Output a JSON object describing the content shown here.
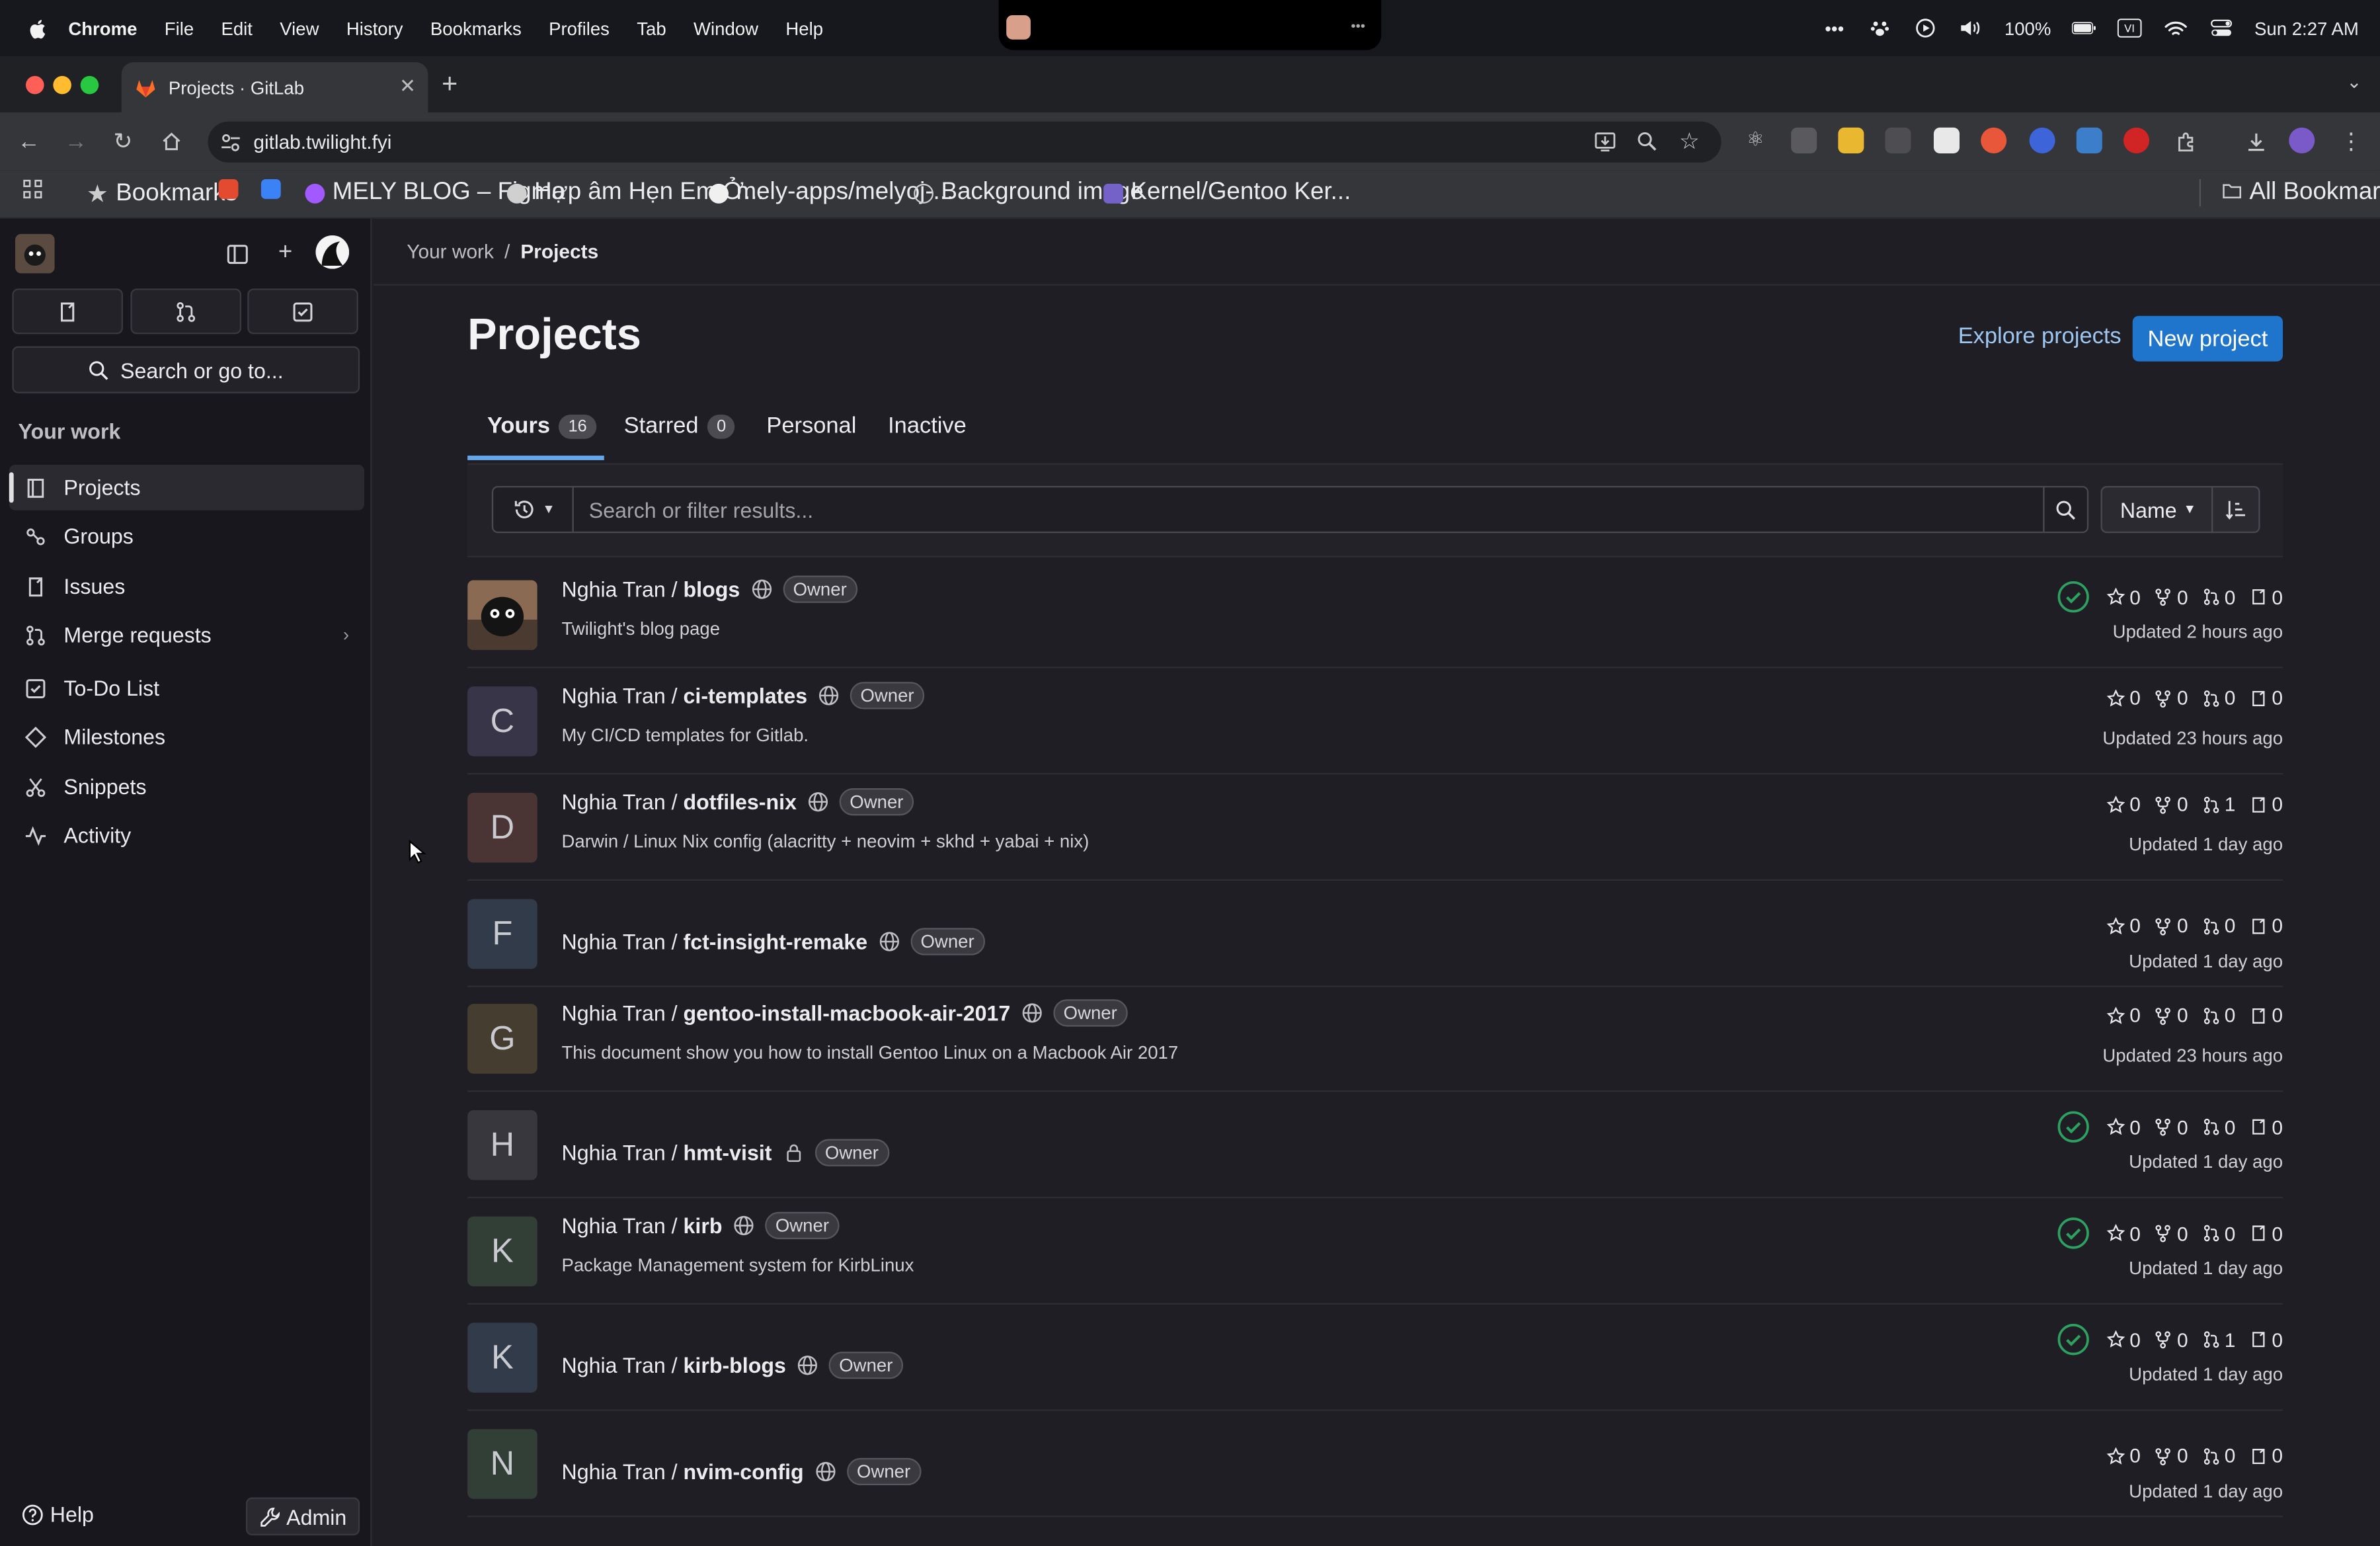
{
  "menubar": {
    "app": "Chrome",
    "items": [
      "File",
      "Edit",
      "View",
      "History",
      "Bookmarks",
      "Profiles",
      "Tab",
      "Window",
      "Help"
    ],
    "battery": "100%",
    "clock": "Sun 2:27 AM"
  },
  "browser": {
    "tab_title": "Projects · GitLab",
    "url": "gitlab.twilight.fyi",
    "bookmarks": [
      "Bookmarks",
      "MELY BLOG – Figma",
      "Hợp âm Hẹn Em Ở...",
      "mely-apps/melyoj-...",
      "Background image",
      "Kernel/Gentoo Ker..."
    ],
    "all_bookmarks": "All Bookmarks"
  },
  "sidebar": {
    "search_label": "Search or go to...",
    "section": "Your work",
    "items": [
      {
        "label": "Projects",
        "icon": "project-icon",
        "active": true
      },
      {
        "label": "Groups",
        "icon": "group-icon"
      },
      {
        "label": "Issues",
        "icon": "issues-icon"
      },
      {
        "label": "Merge requests",
        "icon": "merge-request-icon"
      },
      {
        "label": "To-Do List",
        "icon": "todo-icon"
      },
      {
        "label": "Milestones",
        "icon": "milestone-icon"
      },
      {
        "label": "Snippets",
        "icon": "snippet-icon"
      },
      {
        "label": "Activity",
        "icon": "activity-icon"
      }
    ],
    "help": "Help",
    "admin": "Admin"
  },
  "breadcrumb": {
    "parent": "Your work",
    "current": "Projects"
  },
  "page": {
    "title": "Projects",
    "explore": "Explore projects",
    "new_project": "New project"
  },
  "tabs": [
    {
      "label": "Yours",
      "count": "16"
    },
    {
      "label": "Starred",
      "count": "0"
    },
    {
      "label": "Personal"
    },
    {
      "label": "Inactive"
    }
  ],
  "filter": {
    "placeholder": "Search or filter results...",
    "sort": "Name"
  },
  "projects": [
    {
      "namespace": "Nghia Tran / ",
      "name": "blogs",
      "visibility": "public",
      "role": "Owner",
      "description": "Twilight's blog page",
      "pipeline": true,
      "stars": "0",
      "forks": "0",
      "mrs": "0",
      "issues": "0",
      "updated": "Updated 2 hours ago",
      "letter": "",
      "avatar_color": "#3a3530"
    },
    {
      "namespace": "Nghia Tran / ",
      "name": "ci-templates",
      "visibility": "public",
      "role": "Owner",
      "description": "My CI/CD templates for Gitlab.",
      "pipeline": false,
      "stars": "0",
      "forks": "0",
      "mrs": "0",
      "issues": "0",
      "updated": "Updated 23 hours ago",
      "letter": "C",
      "avatar_color": "#393548"
    },
    {
      "namespace": "Nghia Tran / ",
      "name": "dotfiles-nix",
      "visibility": "public",
      "role": "Owner",
      "description": "Darwin / Linux Nix config (alacritty + neovim + skhd + yabai + nix)",
      "pipeline": false,
      "stars": "0",
      "forks": "0",
      "mrs": "1",
      "issues": "0",
      "updated": "Updated 1 day ago",
      "letter": "D",
      "avatar_color": "#4a3434"
    },
    {
      "namespace": "Nghia Tran / ",
      "name": "fct-insight-remake",
      "visibility": "public",
      "role": "Owner",
      "description": "",
      "pipeline": false,
      "stars": "0",
      "forks": "0",
      "mrs": "0",
      "issues": "0",
      "updated": "Updated 1 day ago",
      "letter": "F",
      "avatar_color": "#313b4a"
    },
    {
      "namespace": "Nghia Tran / ",
      "name": "gentoo-install-macbook-air-2017",
      "visibility": "public",
      "role": "Owner",
      "description": "This document show you how to install Gentoo Linux on a Macbook Air 2017",
      "pipeline": false,
      "stars": "0",
      "forks": "0",
      "mrs": "0",
      "issues": "0",
      "updated": "Updated 23 hours ago",
      "letter": "G",
      "avatar_color": "#453d30"
    },
    {
      "namespace": "Nghia Tran / ",
      "name": "hmt-visit",
      "visibility": "private",
      "role": "Owner",
      "description": "",
      "pipeline": true,
      "stars": "0",
      "forks": "0",
      "mrs": "0",
      "issues": "0",
      "updated": "Updated 1 day ago",
      "letter": "H",
      "avatar_color": "#38373d"
    },
    {
      "namespace": "Nghia Tran / ",
      "name": "kirb",
      "visibility": "public",
      "role": "Owner",
      "description": "Package Management system for KirbLinux",
      "pipeline": true,
      "stars": "0",
      "forks": "0",
      "mrs": "0",
      "issues": "0",
      "updated": "Updated 1 day ago",
      "letter": "K",
      "avatar_color": "#323f36"
    },
    {
      "namespace": "Nghia Tran / ",
      "name": "kirb-blogs",
      "visibility": "public",
      "role": "Owner",
      "description": "",
      "pipeline": true,
      "stars": "0",
      "forks": "0",
      "mrs": "1",
      "issues": "0",
      "updated": "Updated 1 day ago",
      "letter": "K",
      "avatar_color": "#313b4a"
    },
    {
      "namespace": "Nghia Tran / ",
      "name": "nvim-config",
      "visibility": "public",
      "role": "Owner",
      "description": "",
      "pipeline": false,
      "stars": "0",
      "forks": "0",
      "mrs": "0",
      "issues": "0",
      "updated": "Updated 1 day ago",
      "letter": "N",
      "avatar_color": "#323f36"
    }
  ],
  "colors": {
    "accent": "#1f75cb",
    "link": "#9dc7f1",
    "pipeline_success": "#2da160",
    "background": "#1f1e24"
  }
}
